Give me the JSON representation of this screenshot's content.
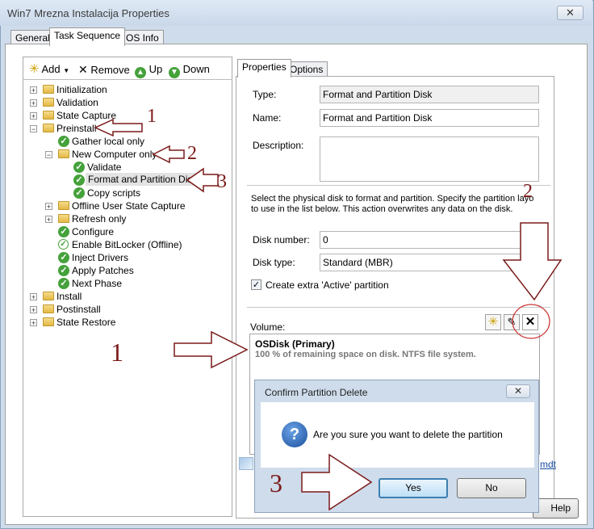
{
  "window": {
    "title": "Win7 Mrezna Instalacija Properties",
    "close_glyph": "✕"
  },
  "tabs": [
    "General",
    "Task Sequence",
    "OS Info"
  ],
  "toolbar": {
    "add": "Add",
    "remove": "Remove",
    "up": "Up",
    "down": "Down"
  },
  "tree": {
    "initialization": "Initialization",
    "validation": "Validation",
    "state_capture": "State Capture",
    "preinstall": "Preinstall",
    "gather_local_only": "Gather local only",
    "new_computer_only": "New Computer only",
    "validate": "Validate",
    "format_partition_disk": "Format and Partition Disk",
    "copy_scripts": "Copy scripts",
    "offline_user_state_capture": "Offline User State Capture",
    "refresh_only": "Refresh only",
    "configure": "Configure",
    "enable_bitlocker": "Enable BitLocker (Offline)",
    "inject_drivers": "Inject Drivers",
    "apply_patches": "Apply Patches",
    "next_phase": "Next Phase",
    "install": "Install",
    "postinstall": "Postinstall",
    "state_restore": "State Restore"
  },
  "props": {
    "tabs": [
      "Properties",
      "Options"
    ],
    "type_label": "Type:",
    "type_value": "Format and Partition Disk",
    "name_label": "Name:",
    "name_value": "Format and Partition Disk",
    "description_label": "Description:",
    "description_value": "",
    "instructions_line1": "Select the physical disk to format and partition.  Specify the partition layo",
    "instructions_line2": "to use in the list below. This action overwrites any data on the disk.",
    "disk_number_label": "Disk number:",
    "disk_number_value": "0",
    "disk_type_label": "Disk type:",
    "disk_type_value": "Standard (MBR)",
    "extra_active_label": "Create extra 'Active' partition",
    "extra_active_checked": true,
    "volume_label": "Volume:",
    "volume_name": "OSDisk (Primary)",
    "volume_desc": "100 % of remaining space on disk. NTFS file system.",
    "link_fragment": "mdt"
  },
  "dialog": {
    "title": "Confirm Partition Delete",
    "message": "Are you sure you want to delete the partition",
    "yes": "Yes",
    "no": "No",
    "icon_glyph": "?"
  },
  "help_button": "Help",
  "annotations": {
    "n1": "1",
    "n2": "2",
    "n3": "3"
  },
  "colors": {
    "annotation": "#7a1a1a",
    "check_green": "#45a23b",
    "chrome": "#cfdceb"
  }
}
